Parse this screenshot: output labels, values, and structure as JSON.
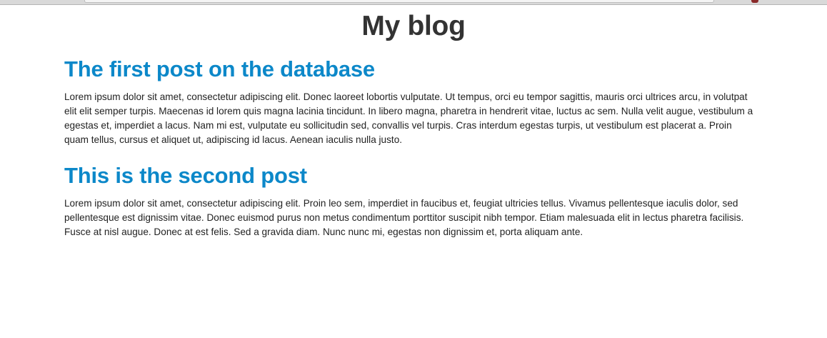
{
  "site": {
    "title": "My blog"
  },
  "posts": [
    {
      "title": "The first post on the database",
      "body": "Lorem ipsum dolor sit amet, consectetur adipiscing elit. Donec laoreet lobortis vulputate. Ut tempus, orci eu tempor sagittis, mauris orci ultrices arcu, in volutpat elit elit semper turpis. Maecenas id lorem quis magna lacinia tincidunt. In libero magna, pharetra in hendrerit vitae, luctus ac sem. Nulla velit augue, vestibulum a egestas et, imperdiet a lacus. Nam mi est, vulputate eu sollicitudin sed, convallis vel turpis. Cras interdum egestas turpis, ut vestibulum est placerat a. Proin quam tellus, cursus et aliquet ut, adipiscing id lacus. Aenean iaculis nulla justo."
    },
    {
      "title": "This is the second post",
      "body": "Lorem ipsum dolor sit amet, consectetur adipiscing elit. Proin leo sem, imperdiet in faucibus et, feugiat ultricies tellus. Vivamus pellentesque iaculis dolor, sed pellentesque est dignissim vitae. Donec euismod purus non metus condimentum porttitor suscipit nibh tempor. Etiam malesuada elit in lectus pharetra facilisis. Fusce at nisl augue. Donec at est felis. Sed a gravida diam. Nunc nunc mi, egestas non dignissim et, porta aliquam ante."
    }
  ],
  "colors": {
    "title_text": "#333333",
    "post_link": "#0c88c9",
    "body_text": "#222222",
    "background": "#ffffff"
  }
}
